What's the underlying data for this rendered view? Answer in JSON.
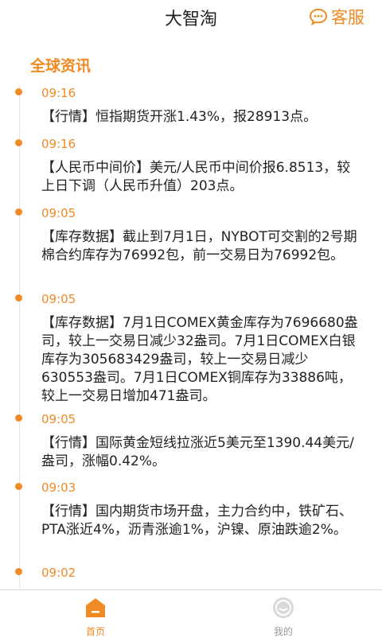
{
  "header": {
    "title": "大智淘",
    "service_label": "客服"
  },
  "section_title": "全球资讯",
  "news": [
    {
      "time": "09:16",
      "text": "【行情】恒指期货开涨1.43%，报28913点。"
    },
    {
      "time": "09:16",
      "text": "【人民币中间价】美元/人民币中间价报6.8513，较上日下调（人民币升值）203点。"
    },
    {
      "time": "09:05",
      "text": "【库存数据】截止到7月1日，NYBOT可交割的2号期棉合约库存为76992包，前一交易日为76992包。"
    },
    {
      "time": "09:05",
      "text": "【库存数据】7月1日COMEX黄金库存为7696680盎司，较上一交易日减少32盎司。7月1日COMEX白银库存为305683429盎司，较上一交易日减少630553盎司。7月1日COMEX铜库存为33886吨，较上一交易日增加471盎司。"
    },
    {
      "time": "09:05",
      "text": "【行情】国际黄金短线拉涨近5美元至1390.44美元/盎司，涨幅0.42%。"
    },
    {
      "time": "09:03",
      "text": "【行情】国内期货市场开盘，主力合约中，铁矿石、PTA涨近4%，沥青涨逾1%，沪镍、原油跌逾2%。"
    },
    {
      "time": "09:02",
      "text": ""
    }
  ],
  "tabs": [
    {
      "label": "首页",
      "active": true
    },
    {
      "label": "我的",
      "active": false
    }
  ],
  "colors": {
    "accent": "#f08a24",
    "inactive": "#9a9a9a"
  }
}
